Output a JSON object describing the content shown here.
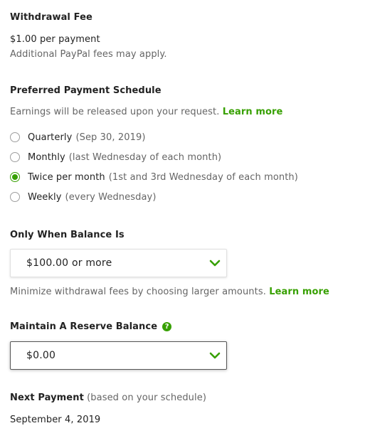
{
  "withdrawal_fee": {
    "heading": "Withdrawal Fee",
    "amount": "$1.00 per payment",
    "note": "Additional PayPal fees may apply."
  },
  "schedule": {
    "heading": "Preferred Payment Schedule",
    "description": "Earnings will be released upon your request.",
    "learn_more": "Learn more",
    "options": [
      {
        "label": "Quarterly",
        "hint": "(Sep 30, 2019)",
        "selected": false
      },
      {
        "label": "Monthly",
        "hint": "(last Wednesday of each month)",
        "selected": false
      },
      {
        "label": "Twice per month",
        "hint": "(1st and 3rd Wednesday of each month)",
        "selected": true
      },
      {
        "label": "Weekly",
        "hint": "(every Wednesday)",
        "selected": false
      }
    ]
  },
  "balance": {
    "heading": "Only When Balance Is",
    "selected_value": "$100.00 or more",
    "note": "Minimize withdrawal fees by choosing larger amounts.",
    "learn_more": "Learn more"
  },
  "reserve": {
    "heading": "Maintain A Reserve Balance",
    "help_icon": "?",
    "selected_value": "$0.00"
  },
  "next_payment": {
    "heading": "Next Payment",
    "hint": "(based on your schedule)",
    "date": "September 4, 2019"
  },
  "colors": {
    "accent": "#37a000",
    "text": "#222222",
    "muted": "#656565"
  },
  "icons": {
    "dropdown": "chevron-down-icon",
    "help": "question-circle-icon"
  }
}
